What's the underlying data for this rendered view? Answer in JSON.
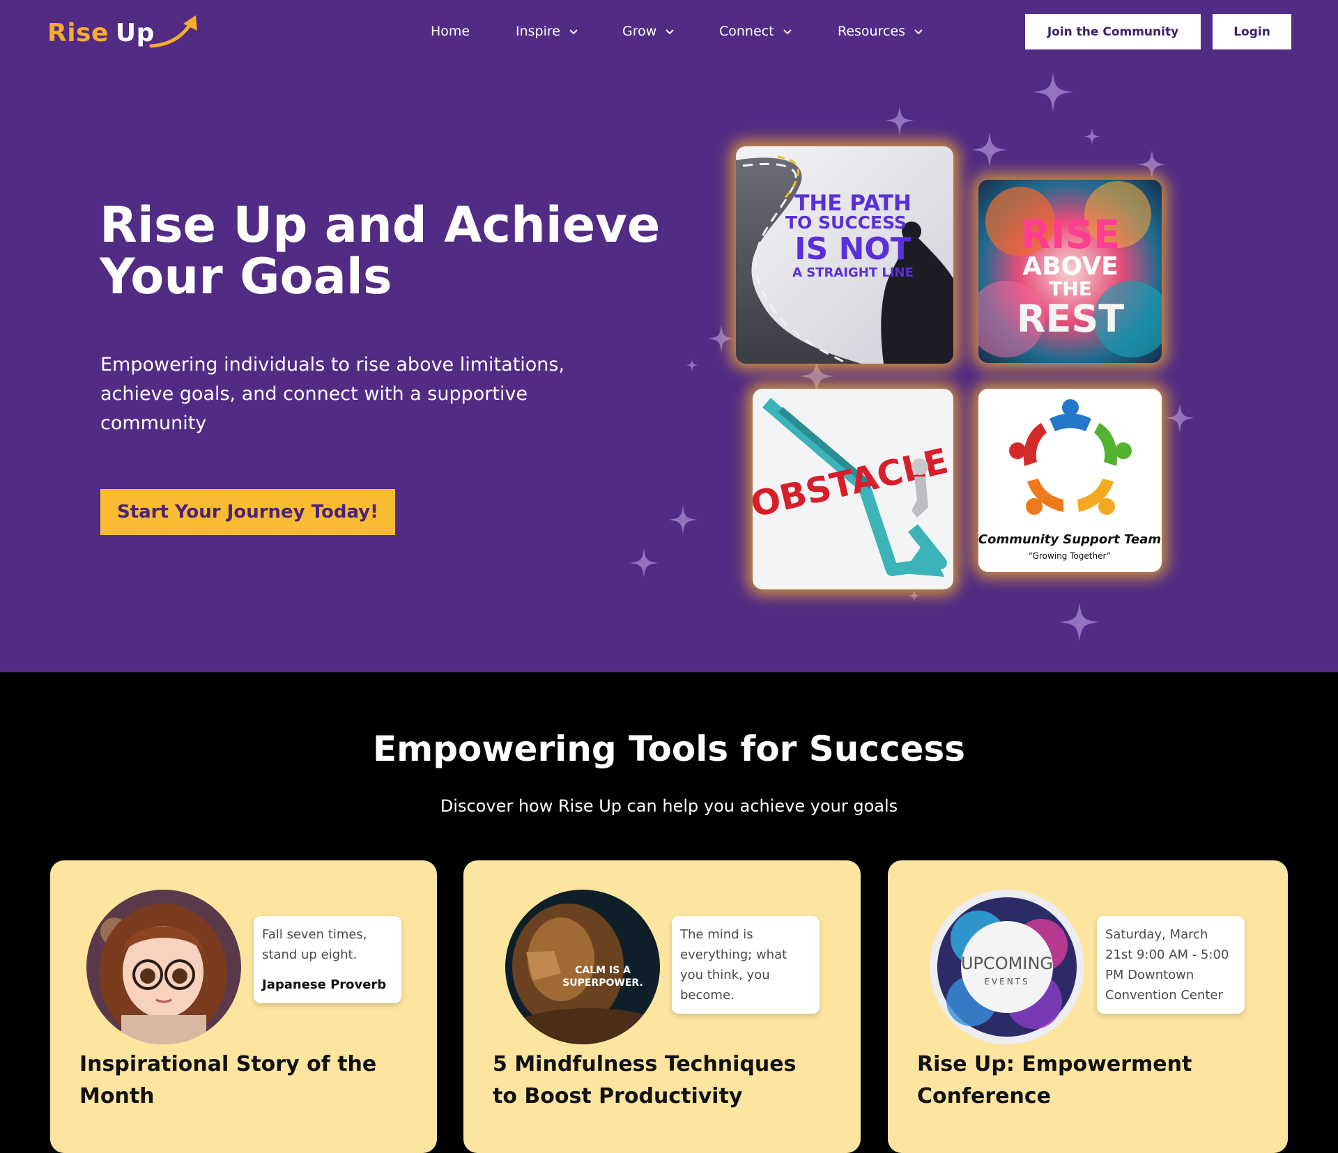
{
  "brand": {
    "rise": "Rise",
    "up": "Up"
  },
  "nav": {
    "items": [
      {
        "label": "Home",
        "dropdown": false
      },
      {
        "label": "Inspire",
        "dropdown": true
      },
      {
        "label": "Grow",
        "dropdown": true
      },
      {
        "label": "Connect",
        "dropdown": true
      },
      {
        "label": "Resources",
        "dropdown": true
      }
    ],
    "join_label": "Join the Community",
    "login_label": "Login"
  },
  "hero": {
    "title": "Rise Up and Achieve Your Goals",
    "subtitle": "Empowering individuals to rise above limitations, achieve goals, and connect with a supportive community",
    "cta_label": "Start Your Journey Today!",
    "tiles": {
      "path": {
        "line1": "THE PATH",
        "line2": "TO SUCCESS",
        "line3": "IS NOT",
        "line4": "A STRAIGHT LINE"
      },
      "rise": {
        "line1": "RISE",
        "line2": "ABOVE",
        "line3": "THE",
        "line4": "REST"
      },
      "obstacle": {
        "word": "OBSTACLE"
      },
      "community": {
        "title": "Community Support Team",
        "tagline": "“Growing Together”"
      }
    }
  },
  "tools": {
    "title": "Empowering Tools for Success",
    "subtitle": "Discover how Rise Up can help you achieve your goals",
    "cards": [
      {
        "quote": "Fall seven times, stand up eight.",
        "author": "Japanese Proverb",
        "title": "Inspirational Story of the Month"
      },
      {
        "quote": "The mind is everything; what you think, you become.",
        "image_text_1": "CALM IS A",
        "image_text_2": "SUPERPOWER.",
        "title": "5 Mindfulness Techniques to Boost Productivity"
      },
      {
        "quote": "Saturday, March 21st 9:00 AM - 5:00 PM Downtown Convention Center",
        "image_text_1": "UPCOMING",
        "image_text_2": "EVENTS",
        "title": "Rise Up: Empowerment Conference"
      }
    ]
  },
  "colors": {
    "hero_bg": "#512b84",
    "accent_gold": "#f9bb32",
    "card_bg": "#fde5a0",
    "brand_orange": "#f6ad2e"
  }
}
